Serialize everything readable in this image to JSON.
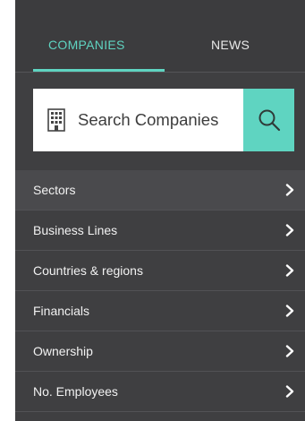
{
  "tabs": {
    "companies": "COMPANIES",
    "news": "NEWS",
    "active": "companies"
  },
  "search": {
    "placeholder": "Search Companies",
    "value": "",
    "icon": "building-icon",
    "button_icon": "search-icon"
  },
  "list": {
    "items": [
      {
        "label": "Sectors",
        "icon": "chevron-right-icon"
      },
      {
        "label": "Business Lines",
        "icon": "chevron-right-icon"
      },
      {
        "label": "Countries & regions",
        "icon": "chevron-right-icon"
      },
      {
        "label": "Financials",
        "icon": "chevron-right-icon"
      },
      {
        "label": "Ownership",
        "icon": "chevron-right-icon"
      },
      {
        "label": "No. Employees",
        "icon": "chevron-right-icon"
      }
    ]
  },
  "colors": {
    "accent": "#5fd4c1",
    "panel": "#3f3f41",
    "highlight_row": "#4a4a4d",
    "text": "#f2f2f2"
  }
}
